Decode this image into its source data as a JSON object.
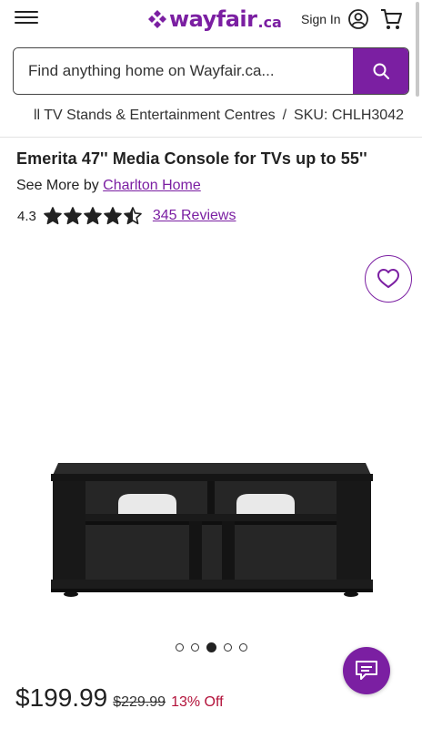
{
  "header": {
    "logo_word": "wayfair",
    "logo_tld": ".ca",
    "signin_label": "Sign In"
  },
  "search": {
    "placeholder": "Find anything home on Wayfair.ca..."
  },
  "breadcrumb": {
    "items": [
      "ll TV Stands & Entertainment Centres"
    ],
    "separator": "/",
    "sku": "SKU: CHLH3042"
  },
  "product": {
    "title": "Emerita 47'' Media Console for TVs up to 55''",
    "see_more_prefix": "See More by",
    "brand": "Charlton Home",
    "rating": "4.3",
    "rating_value": 4.3,
    "rating_max": 5,
    "reviews_label": "345 Reviews",
    "price": "$199.99",
    "old_price": "$229.99",
    "discount": "13% Off"
  },
  "carousel": {
    "total": 5,
    "active_index": 2
  },
  "colors": {
    "brand_purple": "#7b1fa2",
    "discount_red": "#b3123a",
    "text": "#222222"
  },
  "icons": {
    "menu": "hamburger-menu-icon",
    "account": "account-circle-icon",
    "cart": "shopping-cart-icon",
    "search": "search-icon",
    "favorite": "heart-icon",
    "chat": "chat-bubble-icon",
    "star": "star-icon"
  }
}
